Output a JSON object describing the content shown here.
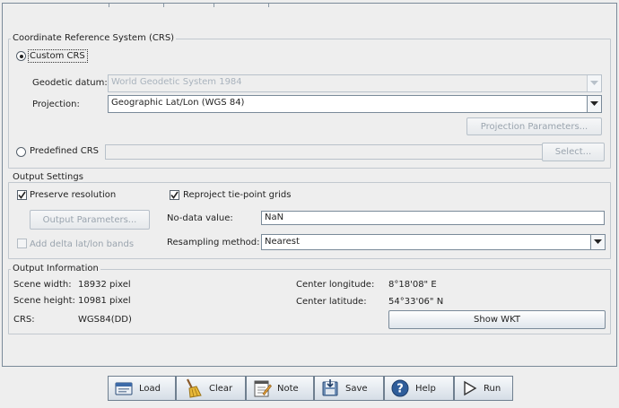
{
  "crs": {
    "legend": "Coordinate Reference System (CRS)",
    "custom_label": "Custom CRS",
    "geodetic_datum_label": "Geodetic datum:",
    "geodetic_datum_value": "World Geodetic System 1984",
    "projection_label": "Projection:",
    "projection_value": "Geographic Lat/Lon (WGS 84)",
    "projection_params_button": "Projection Parameters...",
    "predefined_label": "Predefined CRS",
    "select_button": "Select..."
  },
  "output_settings": {
    "legend": "Output Settings",
    "preserve_resolution": "Preserve resolution",
    "reproject_tiepoints": "Reproject tie-point grids",
    "output_params_button": "Output Parameters...",
    "nodata_label": "No-data value:",
    "nodata_value": "NaN",
    "add_latlon_bands": "Add delta lat/lon bands",
    "resampling_label": "Resampling method:",
    "resampling_value": "Nearest"
  },
  "output_info": {
    "legend": "Output Information",
    "scene_width_label": "Scene width:",
    "scene_width_value": "18932 pixel",
    "scene_height_label": "Scene height:",
    "scene_height_value": "10981 pixel",
    "crs_label": "CRS:",
    "crs_value": "WGS84(DD)",
    "center_lon_label": "Center longitude:",
    "center_lon_value": "8°18'08\" E",
    "center_lat_label": "Center latitude:",
    "center_lat_value": "54°33'06\" N",
    "show_wkt_button": "Show WKT"
  },
  "footer": {
    "load": "Load",
    "clear": "Clear",
    "note": "Note",
    "save": "Save",
    "help": "Help",
    "run": "Run"
  },
  "checks": {
    "custom_crs": true,
    "predefined_crs": false,
    "preserve_resolution": true,
    "reproject_tiepoints": true,
    "add_latlon_bands": false
  }
}
